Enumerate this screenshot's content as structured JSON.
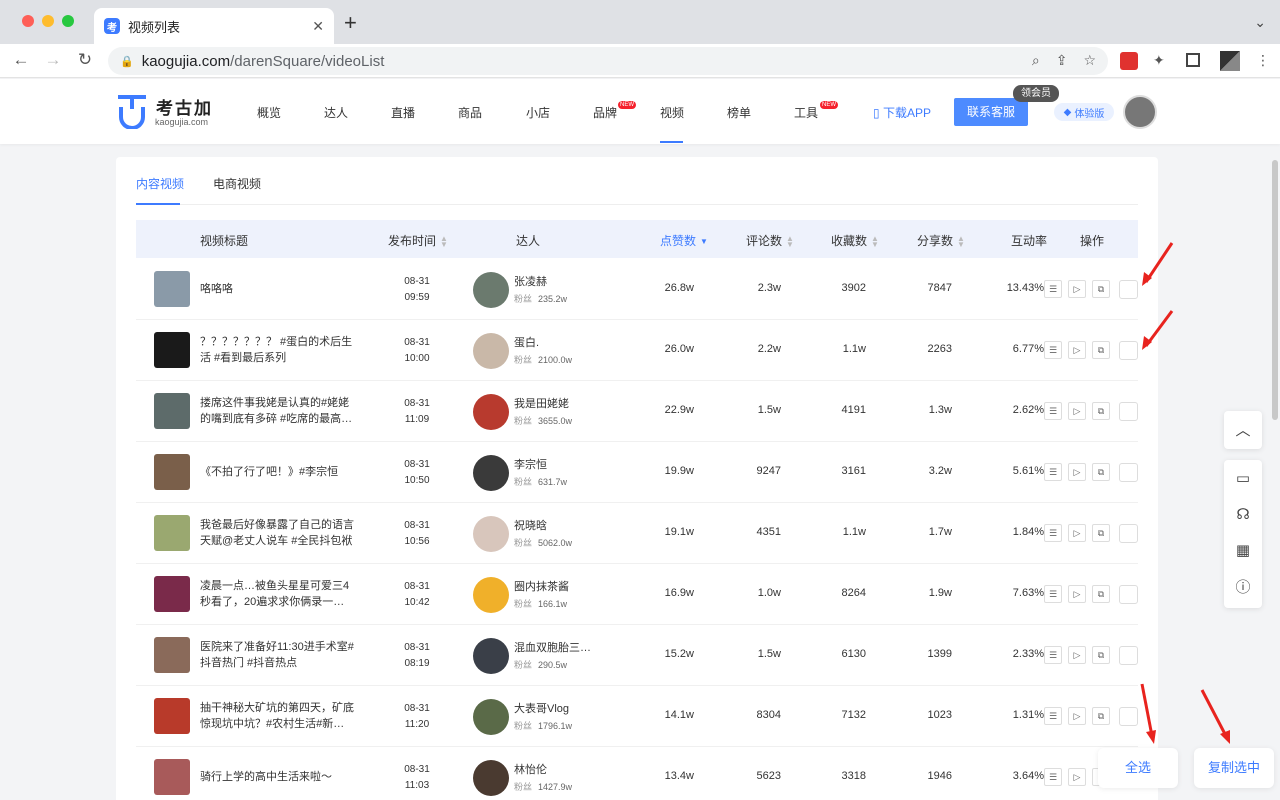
{
  "browser": {
    "tab_title": "视频列表",
    "tab_favicon": "考",
    "url_host": "kaogujia.com",
    "url_path": "/darenSquare/videoList",
    "new_tab_symbol": "+",
    "close_symbol": "✕"
  },
  "site": {
    "logo_name": "考古加",
    "logo_sub": "kaogujia.com",
    "nav": [
      {
        "label": "概览"
      },
      {
        "label": "达人"
      },
      {
        "label": "直播"
      },
      {
        "label": "商品"
      },
      {
        "label": "小店"
      },
      {
        "label": "品牌",
        "badge": "NEW"
      },
      {
        "label": "视频",
        "active": true
      },
      {
        "label": "榜单"
      },
      {
        "label": "工具",
        "badge": "NEW"
      }
    ],
    "download": "下载APP",
    "contact": "联系客服",
    "vip_badge": "领会员",
    "trial": "体验版",
    "accent_color": "#3d7bff"
  },
  "content": {
    "tabs": [
      {
        "label": "内容视频",
        "active": true
      },
      {
        "label": "电商视频"
      }
    ],
    "columns": {
      "title": "视频标题",
      "time": "发布时间",
      "daren": "达人",
      "likes": "点赞数",
      "comments": "评论数",
      "favorites": "收藏数",
      "shares": "分享数",
      "rate": "互动率",
      "ops": "操作"
    },
    "fans_label": "粉丝",
    "rows": [
      {
        "title": "咯咯咯",
        "date": "08-31",
        "time": "09:59",
        "name": "张凌赫",
        "fans": "235.2w",
        "likes": "26.8w",
        "comments": "2.3w",
        "favorites": "3902",
        "shares": "7847",
        "rate": "13.43%",
        "thumb_color": "#8a9aa8",
        "avatar_color": "#6b7a6e"
      },
      {
        "title": "？？？？？？？ #蛋白的术后生活 #看到最后系列",
        "date": "08-31",
        "time": "10:00",
        "name": "蛋白.",
        "fans": "2100.0w",
        "likes": "26.0w",
        "comments": "2.2w",
        "favorites": "1.1w",
        "shares": "2263",
        "rate": "6.77%",
        "thumb_color": "#1a1a1a",
        "avatar_color": "#c9b8a8"
      },
      {
        "title": "搂席这件事我姥是认真的#姥姥的嘴到底有多碎 #吃席的最高…",
        "date": "08-31",
        "time": "11:09",
        "name": "我是田姥姥",
        "fans": "3655.0w",
        "likes": "22.9w",
        "comments": "1.5w",
        "favorites": "4191",
        "shares": "1.3w",
        "rate": "2.62%",
        "thumb_color": "#5d6b6a",
        "avatar_color": "#b83a2e"
      },
      {
        "title": "《不拍了行了吧！》#李宗恒",
        "date": "08-31",
        "time": "10:50",
        "name": "李宗恒",
        "fans": "631.7w",
        "likes": "19.9w",
        "comments": "9247",
        "favorites": "3161",
        "shares": "3.2w",
        "rate": "5.61%",
        "thumb_color": "#7a5f4a",
        "avatar_color": "#3a3a3a"
      },
      {
        "title": "我爸最后好像暴露了自己的语言天赋@老丈人说车 #全民抖包袱",
        "date": "08-31",
        "time": "10:56",
        "name": "祝晓晗",
        "fans": "5062.0w",
        "likes": "19.1w",
        "comments": "4351",
        "favorites": "1.1w",
        "shares": "1.7w",
        "rate": "1.84%",
        "thumb_color": "#9aa870",
        "avatar_color": "#d8c6bc"
      },
      {
        "title": "凌晨一点…被鱼头星星可爱三4秒看了，20遍求求你俩录一…",
        "date": "08-31",
        "time": "10:42",
        "name": "圈内抹茶酱",
        "fans": "166.1w",
        "likes": "16.9w",
        "comments": "1.0w",
        "favorites": "8264",
        "shares": "1.9w",
        "rate": "7.63%",
        "thumb_color": "#7a2a4a",
        "avatar_color": "#f0b02a"
      },
      {
        "title": "医院来了准备好11:30进手术室#抖音热门 #抖音热点",
        "date": "08-31",
        "time": "08:19",
        "name": "混血双胞胎三…",
        "fans": "290.5w",
        "likes": "15.2w",
        "comments": "1.5w",
        "favorites": "6130",
        "shares": "1399",
        "rate": "2.33%",
        "thumb_color": "#8a6a5a",
        "avatar_color": "#3a3f48"
      },
      {
        "title": "抽干神秘大矿坑的第四天，矿底惊现坑中坑？#农村生活#新…",
        "date": "08-31",
        "time": "11:20",
        "name": "大表哥Vlog",
        "fans": "1796.1w",
        "likes": "14.1w",
        "comments": "8304",
        "favorites": "7132",
        "shares": "1023",
        "rate": "1.31%",
        "thumb_color": "#b83a2a",
        "avatar_color": "#5a6a48"
      },
      {
        "title": "骑行上学的高中生活来啦～",
        "date": "08-31",
        "time": "11:03",
        "name": "林怡伦",
        "fans": "1427.9w",
        "likes": "13.4w",
        "comments": "5623",
        "favorites": "3318",
        "shares": "1946",
        "rate": "3.64%",
        "thumb_color": "#a85a5a",
        "avatar_color": "#4a3a30"
      }
    ]
  },
  "float_buttons": [
    "up-icon",
    "monitor-icon",
    "headset-icon",
    "qrcode-icon",
    "help-icon"
  ],
  "actions": {
    "select_all": "全选",
    "copy_selected": "复制选中"
  }
}
